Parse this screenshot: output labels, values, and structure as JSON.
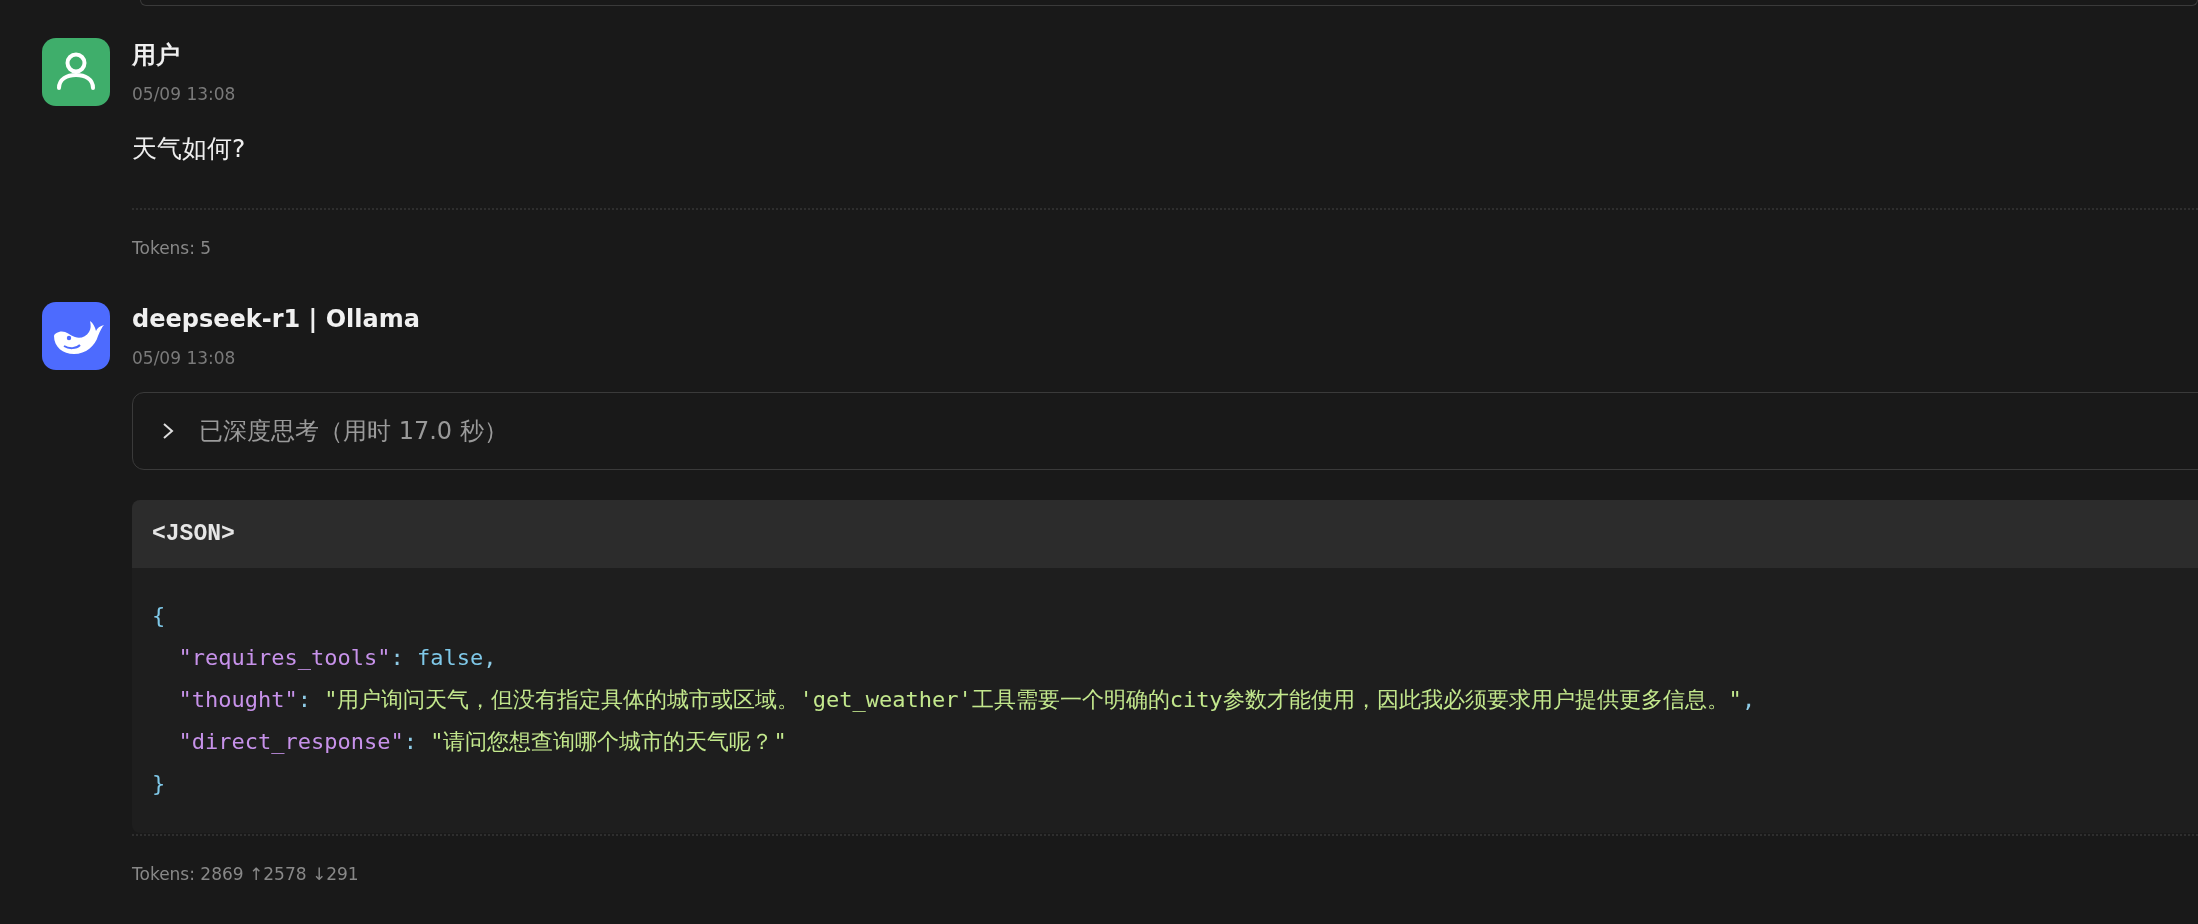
{
  "messages": [
    {
      "kind": "user",
      "name": "用户",
      "time": "05/09 13:08",
      "text": "天气如何?",
      "tokens": "Tokens: 5"
    },
    {
      "kind": "assistant",
      "name": "deepseek-r1 | Ollama",
      "time": "05/09 13:08",
      "thinking": {
        "label": "已深度思考（用时 17.0 秒）",
        "expanded": false
      },
      "code": {
        "language": "<JSON>",
        "lines": [
          [
            {
              "kind": "brace",
              "text": "{"
            }
          ],
          [
            {
              "kind": "key",
              "text": "  \"requires_tools\""
            },
            {
              "kind": "punct",
              "text": ": "
            },
            {
              "kind": "keyword",
              "text": "false"
            },
            {
              "kind": "punct",
              "text": ","
            }
          ],
          [
            {
              "kind": "key",
              "text": "  \"thought\""
            },
            {
              "kind": "punct",
              "text": ": "
            },
            {
              "kind": "string",
              "text": "\"用户询问天气，但没有指定具体的城市或区域。'get_weather'工具需要一个明确的city参数才能使用，因此我必须要求用户提供更多信息。\""
            },
            {
              "kind": "punct",
              "text": ","
            }
          ],
          [
            {
              "kind": "key",
              "text": "  \"direct_response\""
            },
            {
              "kind": "punct",
              "text": ": "
            },
            {
              "kind": "string",
              "text": "\"请问您想查询哪个城市的天气呢？\""
            }
          ],
          [
            {
              "kind": "brace",
              "text": "}"
            }
          ]
        ]
      },
      "tokens": "Tokens: 2869 ↑2578 ↓291"
    }
  ]
}
